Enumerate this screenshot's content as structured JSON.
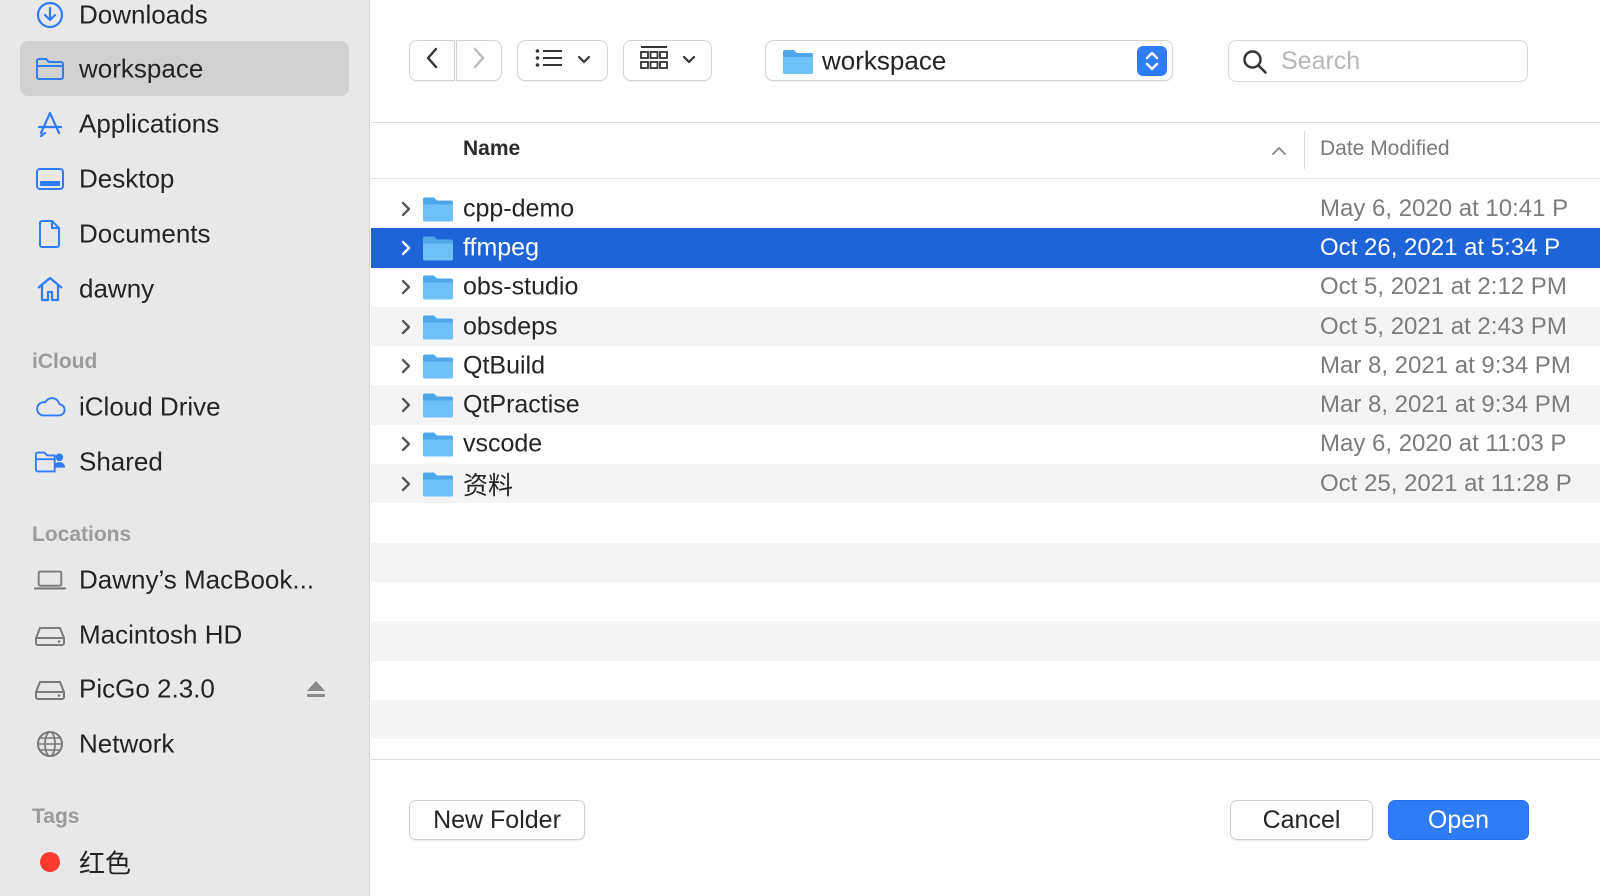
{
  "sidebar": {
    "favorites": [
      {
        "label": "Downloads",
        "icon": "downloads-icon"
      },
      {
        "label": "workspace",
        "icon": "folder-icon",
        "selected": true
      },
      {
        "label": "Applications",
        "icon": "applications-icon"
      },
      {
        "label": "Desktop",
        "icon": "desktop-icon"
      },
      {
        "label": "Documents",
        "icon": "document-icon"
      },
      {
        "label": "dawny",
        "icon": "home-icon"
      }
    ],
    "icloud_header": "iCloud",
    "icloud": [
      {
        "label": "iCloud Drive",
        "icon": "cloud-icon"
      },
      {
        "label": "Shared",
        "icon": "shared-folder-icon"
      }
    ],
    "locations_header": "Locations",
    "locations": [
      {
        "label": "Dawny’s MacBook...",
        "icon": "laptop-icon"
      },
      {
        "label": "Macintosh HD",
        "icon": "disk-icon"
      },
      {
        "label": "PicGo 2.3.0",
        "icon": "disk-icon",
        "ejectable": true
      },
      {
        "label": "Network",
        "icon": "globe-icon"
      }
    ],
    "tags_header": "Tags",
    "tags": [
      {
        "label": "红色",
        "color": "#ff3b30"
      }
    ]
  },
  "toolbar": {
    "path_label": "workspace",
    "search_placeholder": "Search"
  },
  "columns": {
    "name": "Name",
    "date": "Date Modified"
  },
  "files": [
    {
      "name": "cpp-demo",
      "date": "May 6, 2020 at 10:41 P"
    },
    {
      "name": "ffmpeg",
      "date": "Oct 26, 2021 at 5:34 P",
      "selected": true
    },
    {
      "name": "obs-studio",
      "date": "Oct 5, 2021 at 2:12 PM"
    },
    {
      "name": "obsdeps",
      "date": "Oct 5, 2021 at 2:43 PM"
    },
    {
      "name": "QtBuild",
      "date": "Mar 8, 2021 at 9:34 PM"
    },
    {
      "name": "QtPractise",
      "date": "Mar 8, 2021 at 9:34 PM"
    },
    {
      "name": "vscode",
      "date": "May 6, 2020 at 11:03 P"
    },
    {
      "name": "资料",
      "date": "Oct 25, 2021 at 11:28 P"
    }
  ],
  "buttons": {
    "new_folder": "New Folder",
    "cancel": "Cancel",
    "open": "Open"
  },
  "colors": {
    "accent": "#2f7cf6",
    "selection": "#1f63d9",
    "sidebar_bg": "#e9e8e8",
    "sidebar_icon": "#2f7cf6"
  }
}
